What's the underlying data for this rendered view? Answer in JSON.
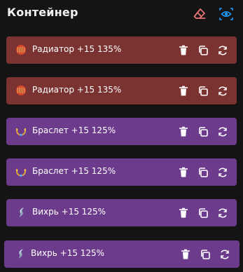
{
  "header": {
    "title": "Контейнер",
    "eraser_color": "#e57373",
    "eye_color": "#2196f3"
  },
  "colors": {
    "background": "#141414",
    "red_row": "#7a3331",
    "purple_row": "#6d3b8b"
  },
  "items": [
    {
      "label": "Радиатор +15 135%",
      "icon": "radiator-icon",
      "style": "red"
    },
    {
      "label": "Радиатор +15 135%",
      "icon": "radiator-icon",
      "style": "red"
    },
    {
      "label": "Браслет +15 125%",
      "icon": "bracelet-icon",
      "style": "purple"
    },
    {
      "label": "Браслет +15 125%",
      "icon": "bracelet-icon",
      "style": "purple"
    },
    {
      "label": "Вихрь +15 125%",
      "icon": "whirl-icon",
      "style": "purple"
    },
    {
      "label": "Вихрь +15 125%",
      "icon": "whirl-icon",
      "style": "purple"
    }
  ],
  "actions": {
    "delete": "trash-icon",
    "copy": "copy-icon",
    "replace": "swap-icon"
  }
}
